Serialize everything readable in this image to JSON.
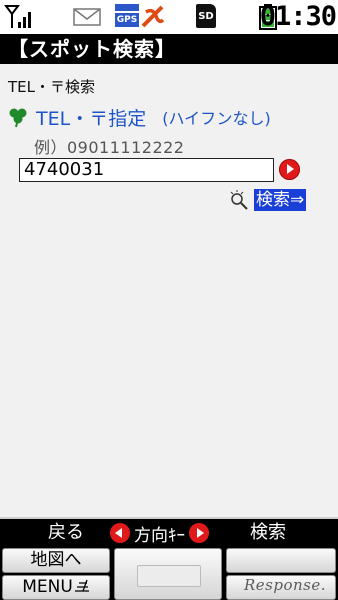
{
  "status_bar": {
    "signal_icon": "signal-bars-icon",
    "mail_icon": "mail-icon",
    "gps_label": "GPS",
    "ez_icon": "ezweb-icon",
    "sd_label": "SD",
    "battery_icon": "battery-icon",
    "clock": "01:30"
  },
  "title_bar": {
    "title": "【スポット検索】"
  },
  "main": {
    "section_label": "TEL・〒検索",
    "field_title": "TEL・〒指定",
    "field_note": "(ハイフンなし)",
    "example": "例）09011112222",
    "input_value": "4740031",
    "search_link": "検索⇒"
  },
  "softkeys": {
    "left": "戻る",
    "center": "方向ｷｰ",
    "right": "検索"
  },
  "function_keys": {
    "map": "地図へ",
    "menu": "MENU"
  },
  "watermark": "Response.",
  "colors": {
    "accent_blue": "#1f55c8",
    "highlight_blue": "#1a3fd6",
    "red_button": "#e01a1a",
    "background": "#f1f1f1"
  }
}
